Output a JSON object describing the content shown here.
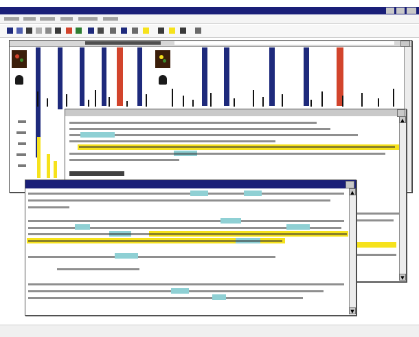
{
  "app": {
    "title": "",
    "menu": []
  },
  "toolbar": {
    "icons": [
      "new-doc-icon",
      "open-icon",
      "save-icon",
      "print-icon",
      "cut-icon",
      "copy-icon",
      "paste-icon",
      "undo-icon",
      "find-icon",
      "zoom-icon",
      "align-left-icon",
      "align-center-icon",
      "align-right-icon",
      "bold-icon",
      "italic-icon",
      "help-icon"
    ]
  },
  "matrix_window": {
    "title": "",
    "column_colors": [
      "#1e2a7c",
      "#1e2a7c",
      "#1e2a7c",
      "#1e2a7c",
      "#d2442c",
      "#1e2a7c",
      "#1e2a7c",
      "#1e2a7c",
      "#1e2a7c",
      "#1e2a7c",
      "#d2442c"
    ]
  },
  "middle_window": {
    "title": "",
    "heading": ""
  },
  "front_window": {
    "title": ""
  },
  "colors": {
    "titlebar": "#1a1f78",
    "highlight_yellow": "#f6e21c",
    "highlight_cyan": "#8fd0d4",
    "bar_blue": "#1e2a7c",
    "bar_red": "#d2442c"
  },
  "status_bar": {
    "text": ""
  }
}
